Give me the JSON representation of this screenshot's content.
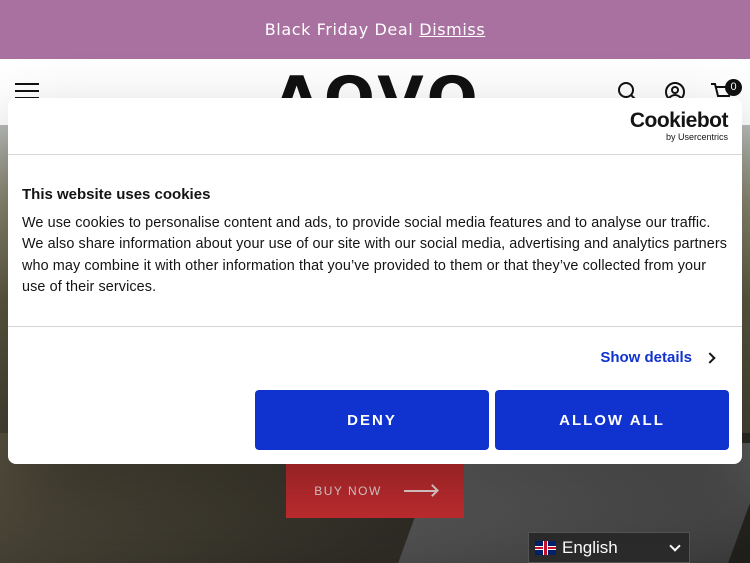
{
  "promo": {
    "text": "Black Friday Deal",
    "dismiss": "Dismiss"
  },
  "header": {
    "logo": "AOVO",
    "cart_count": "0"
  },
  "hero": {
    "cta": "BUY NOW"
  },
  "cookie": {
    "brand_name": "Cookiebot",
    "brand_sub": "by Usercentrics",
    "title": "This website uses cookies",
    "body": "We use cookies to personalise content and ads, to provide social media features and to analyse our traffic. We also share information about your use of our site with our social media, advertising and analytics partners who may combine it with other information that you’ve provided to them or that they’ve collected from your use of their services.",
    "show_details": "Show details",
    "deny": "DENY",
    "allow_all": "ALLOW ALL"
  },
  "language": {
    "selected": "English"
  },
  "colors": {
    "accent": "#1032cf",
    "promo": "#a8719f",
    "cta": "#c72e31"
  },
  "icons": [
    "menu-icon",
    "search-icon",
    "account-icon",
    "cart-icon",
    "chevron-right-icon",
    "uk-flag-icon",
    "chevron-down-icon"
  ]
}
